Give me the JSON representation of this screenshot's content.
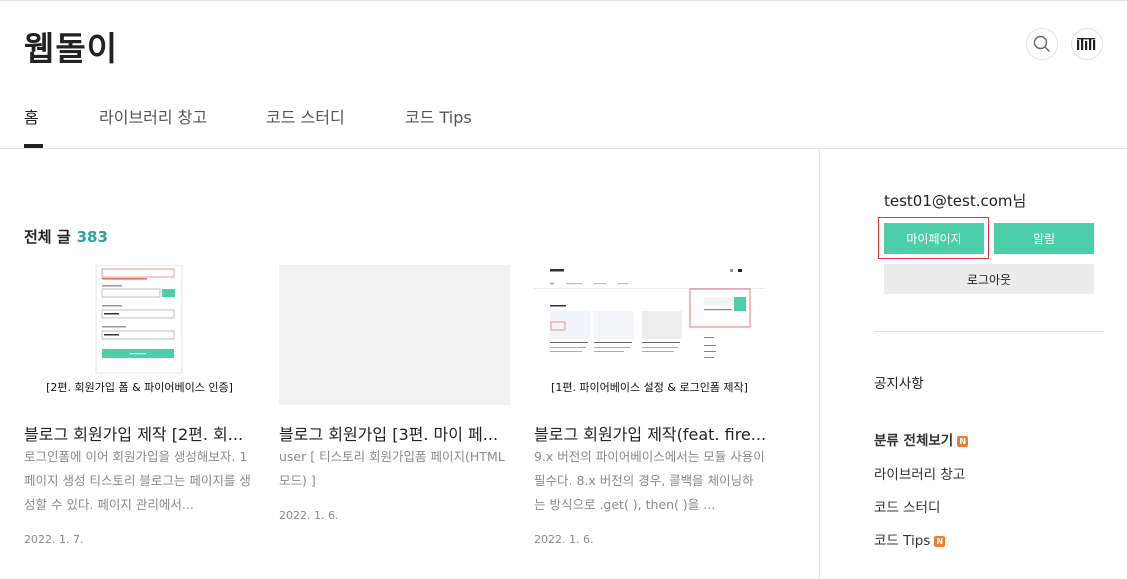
{
  "header": {
    "blog_title": "웹돌이",
    "search_icon": "search-icon",
    "avatar_icon": "avatar"
  },
  "tabs": [
    {
      "label": "홈",
      "active": true
    },
    {
      "label": "라이브러리 창고",
      "active": false
    },
    {
      "label": "코드 스터디",
      "active": false
    },
    {
      "label": "코드 Tips",
      "active": false
    }
  ],
  "main": {
    "section_title": "전체 글",
    "post_count": "383",
    "posts": [
      {
        "thumb_caption": "[2편. 회원가입 폼 & 파이어베이스 인증]",
        "title": "블로그 회원가입 제작 [2편. 회...",
        "summary": "로그인폼에 이어 회원가입을 생성해보자. 1 페이지 생성 티스토리 블로그는 페이지를 생성할 수 있다. 페이지 관리에서...",
        "date": "2022. 1. 7."
      },
      {
        "thumb_caption": "",
        "title": "블로그 회원가입 [3편. 마이 페...",
        "summary": "user [ 티스토리 회원가입폼 페이지(HTML모드) ]",
        "date": "2022. 1. 6."
      },
      {
        "thumb_caption": "[1편. 파이어베이스 설정 & 로그인폼 제작]",
        "title": "블로그 회원가입 제작(feat. fire...",
        "summary": "9.x 버전의 파이어베이스에서는 모듈 사용이 필수다. 8.x 버전의 경우, 콜백을 체이닝하는 방식으로 .get( ), then( )을 ...",
        "date": "2022. 1. 6."
      }
    ]
  },
  "sidebar": {
    "user": "test01@test.com님",
    "mypage_label": "마이페이지",
    "alarm_label": "알림",
    "logout_label": "로그아웃",
    "notice_label": "공지사항",
    "category_all_label": "분류 전체보기",
    "categories": [
      {
        "label": "라이브러리 창고",
        "new": false
      },
      {
        "label": "코드 스터디",
        "new": false
      },
      {
        "label": "코드 Tips",
        "new": true
      }
    ],
    "new_badge": "N"
  },
  "colors": {
    "accent": "#4ccfa9",
    "count": "#2aa4a4",
    "badge": "#f07d2f",
    "highlight_border": "#d63a3a"
  }
}
